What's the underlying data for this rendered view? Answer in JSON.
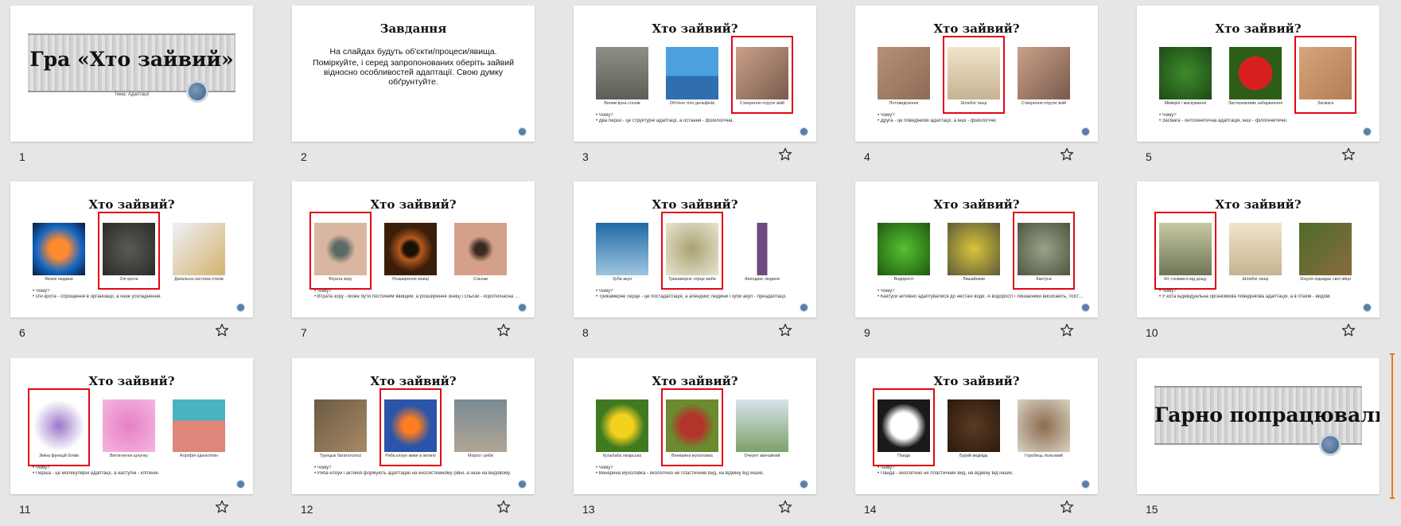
{
  "app": "Slide Sorter",
  "colors": {
    "selection_outline": "#e30613",
    "slide_bg": "#ffffff",
    "workspace_bg": "#e6e6e6"
  },
  "slides": [
    {
      "number": "1",
      "type": "title",
      "title": "Гра «Хто зайвий»",
      "subtitle": "Тема: Адаптації"
    },
    {
      "number": "2",
      "type": "text",
      "title": "Завдання",
      "body": [
        "На слайдах будуть об'єкти/процеси/явища.",
        "Поміркуйте, і серед запропонованих оберіть зайвий відносно особливостей адаптації. Свою думку обґрунтуйте."
      ]
    },
    {
      "number": "3",
      "type": "quiz",
      "title": "Хто зайвий?",
      "selected": 2,
      "captions": [
        "Великі вуха слонів",
        "Обтічне тіло дельфінів",
        "Створення отрути змій"
      ],
      "bullets": [
        "Чому?",
        "Два перші - це структурні адаптації, а остання - фізіологічна."
      ]
    },
    {
      "number": "4",
      "type": "quiz",
      "title": "Хто зайвий?",
      "selected": 1,
      "captions": [
        "Потовиділення",
        "Шлюбні танці",
        "Створення отрути змій"
      ],
      "bullets": [
        "Чому?",
        "Друга - це поведінкові адаптації, а інші - фізіологічні."
      ]
    },
    {
      "number": "5",
      "type": "quiz",
      "title": "Хто зайвий?",
      "selected": 2,
      "captions": [
        "Мімікрія і маскування",
        "Застережливе забарвлення",
        "Засмага"
      ],
      "bullets": [
        "Чому?",
        "Засмага - онтогенетична адаптація, інші - філогенетичні."
      ]
    },
    {
      "number": "6",
      "type": "quiz",
      "title": "Хто зайвий?",
      "selected": 1,
      "captions": [
        "Мозок людини",
        "Очі крота",
        "Дихальна система птахів"
      ],
      "bullets": [
        "Чому?",
        "Очі крота - спрощення в організації, а інше ускладнення."
      ]
    },
    {
      "number": "7",
      "type": "quiz",
      "title": "Хто зайвий?",
      "selected": 0,
      "captions": [
        "Втрата зору",
        "Розширення зіниці",
        "Сльози"
      ],
      "bullets": [
        "Чому?",
        "Втрата зору - може бути постійним явищем, а розширення зіниці і сльози - короткочасна адаптація."
      ]
    },
    {
      "number": "8",
      "type": "quiz",
      "title": "Хто зайвий?",
      "selected": 1,
      "captions": [
        "Зуби акул",
        "Трикамерне серце жаби",
        "Апендикс людини"
      ],
      "bullets": [
        "Чому?",
        "Трикамерне серце - це постадаптація, а апендикс людини і зуби акул - преадаптації."
      ]
    },
    {
      "number": "9",
      "type": "quiz",
      "title": "Хто зайвий?",
      "selected": 2,
      "captions": [
        "Водорості",
        "Лишайники",
        "Кактуси"
      ],
      "bullets": [
        "Чому?",
        "Кактуси активно адаптувалися до нестачі води. А водорості і лишайники висихають, тобто пасивна адаптація."
      ]
    },
    {
      "number": "10",
      "type": "quiz",
      "title": "Хто зайвий?",
      "selected": 0,
      "captions": [
        "Кіт сховався від дощу",
        "Шлюбні танці",
        "Зозуля підкидає свої яйця"
      ],
      "bullets": [
        "Чому?",
        "У кота індивідуальна організмова поведінкова адаптація, а в птахів - видові."
      ]
    },
    {
      "number": "11",
      "type": "quiz",
      "title": "Хто зайвий?",
      "selected": 0,
      "captions": [
        "Зміна функцій білків",
        "Витягнення шлунку",
        "Атрофія одноклітин"
      ],
      "bullets": [
        "Чому?",
        "Перша - це молекулярні адаптації, а наступні - клітинні."
      ]
    },
    {
      "number": "12",
      "type": "quiz",
      "title": "Хто зайвий?",
      "selected": 1,
      "captions": [
        "Турецькі багатоголосі",
        "Риба клоун живе в актинії",
        "Мороз і риби"
      ],
      "bullets": [
        "Чому?",
        "Риба клоун і актинія формують адаптацію на екосистемному рівні, а інше на видовому."
      ]
    },
    {
      "number": "13",
      "type": "quiz",
      "title": "Хто зайвий?",
      "selected": 1,
      "captions": [
        "Кульбаба лікарська",
        "Венерина мухоловка",
        "Очерет звичайний"
      ],
      "bullets": [
        "Чому?",
        "Венерина мухоловка - екологічно не пластичний вид, на відміну від інших."
      ]
    },
    {
      "number": "14",
      "type": "quiz",
      "title": "Хто зайвий?",
      "selected": 0,
      "captions": [
        "Панда",
        "Бурий ведмідь",
        "Горобець польовий"
      ],
      "bullets": [
        "Чому?",
        "Панда - екологічно не пластичний вид, на відміну від інших."
      ]
    },
    {
      "number": "15",
      "type": "end",
      "title": "Гарно попрацювали!"
    }
  ]
}
